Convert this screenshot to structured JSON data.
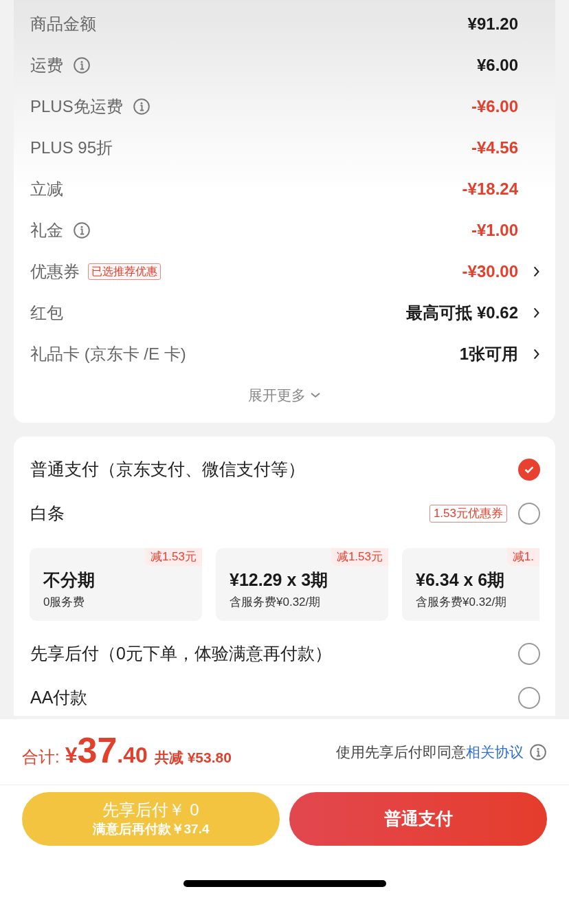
{
  "summary": {
    "rows": [
      {
        "label": "商品金额",
        "info": false,
        "amount": "¥91.20",
        "kind": "plain",
        "arrow": false
      },
      {
        "label": "运费",
        "info": true,
        "amount": "¥6.00",
        "kind": "plain",
        "arrow": false
      },
      {
        "label": "PLUS免运费",
        "info": true,
        "amount": "-¥6.00",
        "kind": "discount",
        "arrow": false
      },
      {
        "label": "PLUS 95折",
        "info": false,
        "amount": "-¥4.56",
        "kind": "discount",
        "arrow": false
      },
      {
        "label": "立减",
        "info": false,
        "amount": "-¥18.24",
        "kind": "discount",
        "arrow": false
      },
      {
        "label": "礼金",
        "info": true,
        "amount": "-¥1.00",
        "kind": "discount",
        "arrow": false
      },
      {
        "label": "优惠券",
        "info": false,
        "tag": "已选推荐优惠",
        "amount": "-¥30.00",
        "kind": "discount",
        "arrow": true
      },
      {
        "label": "红包",
        "info": false,
        "amount": "最高可抵 ¥0.62",
        "kind": "plain",
        "arrow": true
      },
      {
        "label": "礼品卡 (京东卡 /E 卡)",
        "info": false,
        "amount": "1张可用",
        "kind": "plain",
        "arrow": true
      }
    ],
    "expand": "展开更多"
  },
  "payment": {
    "methods": [
      {
        "label": "普通支付（京东支付、微信支付等）",
        "selected": true
      },
      {
        "label": "白条",
        "tag": "1.53元优惠券",
        "selected": false,
        "plans": [
          {
            "badge": "减1.53元",
            "title": "不分期",
            "note": "0服务费"
          },
          {
            "badge": "减1.53元",
            "title": "¥12.29 x 3期",
            "note": "含服务费¥0.32/期"
          },
          {
            "badge": "减1.",
            "title": "¥6.34 x 6期",
            "note": "含服务费¥0.32/期"
          }
        ]
      },
      {
        "label": "先享后付（0元下单，体验满意再付款）",
        "selected": false
      },
      {
        "label": "AA付款",
        "selected": false
      }
    ]
  },
  "footer": {
    "total_label": "合计:",
    "currency": "¥",
    "total_int": "37",
    "total_dec": ".40",
    "saved": "共减 ¥53.80",
    "agree_text": "使用先享后付即同意",
    "agree_link": "相关协议",
    "buttons": [
      {
        "kind": "later",
        "line1": "先享后付￥ 0",
        "line2": "满意后再付款￥37.4"
      },
      {
        "kind": "pay",
        "line1": "普通支付"
      }
    ]
  }
}
